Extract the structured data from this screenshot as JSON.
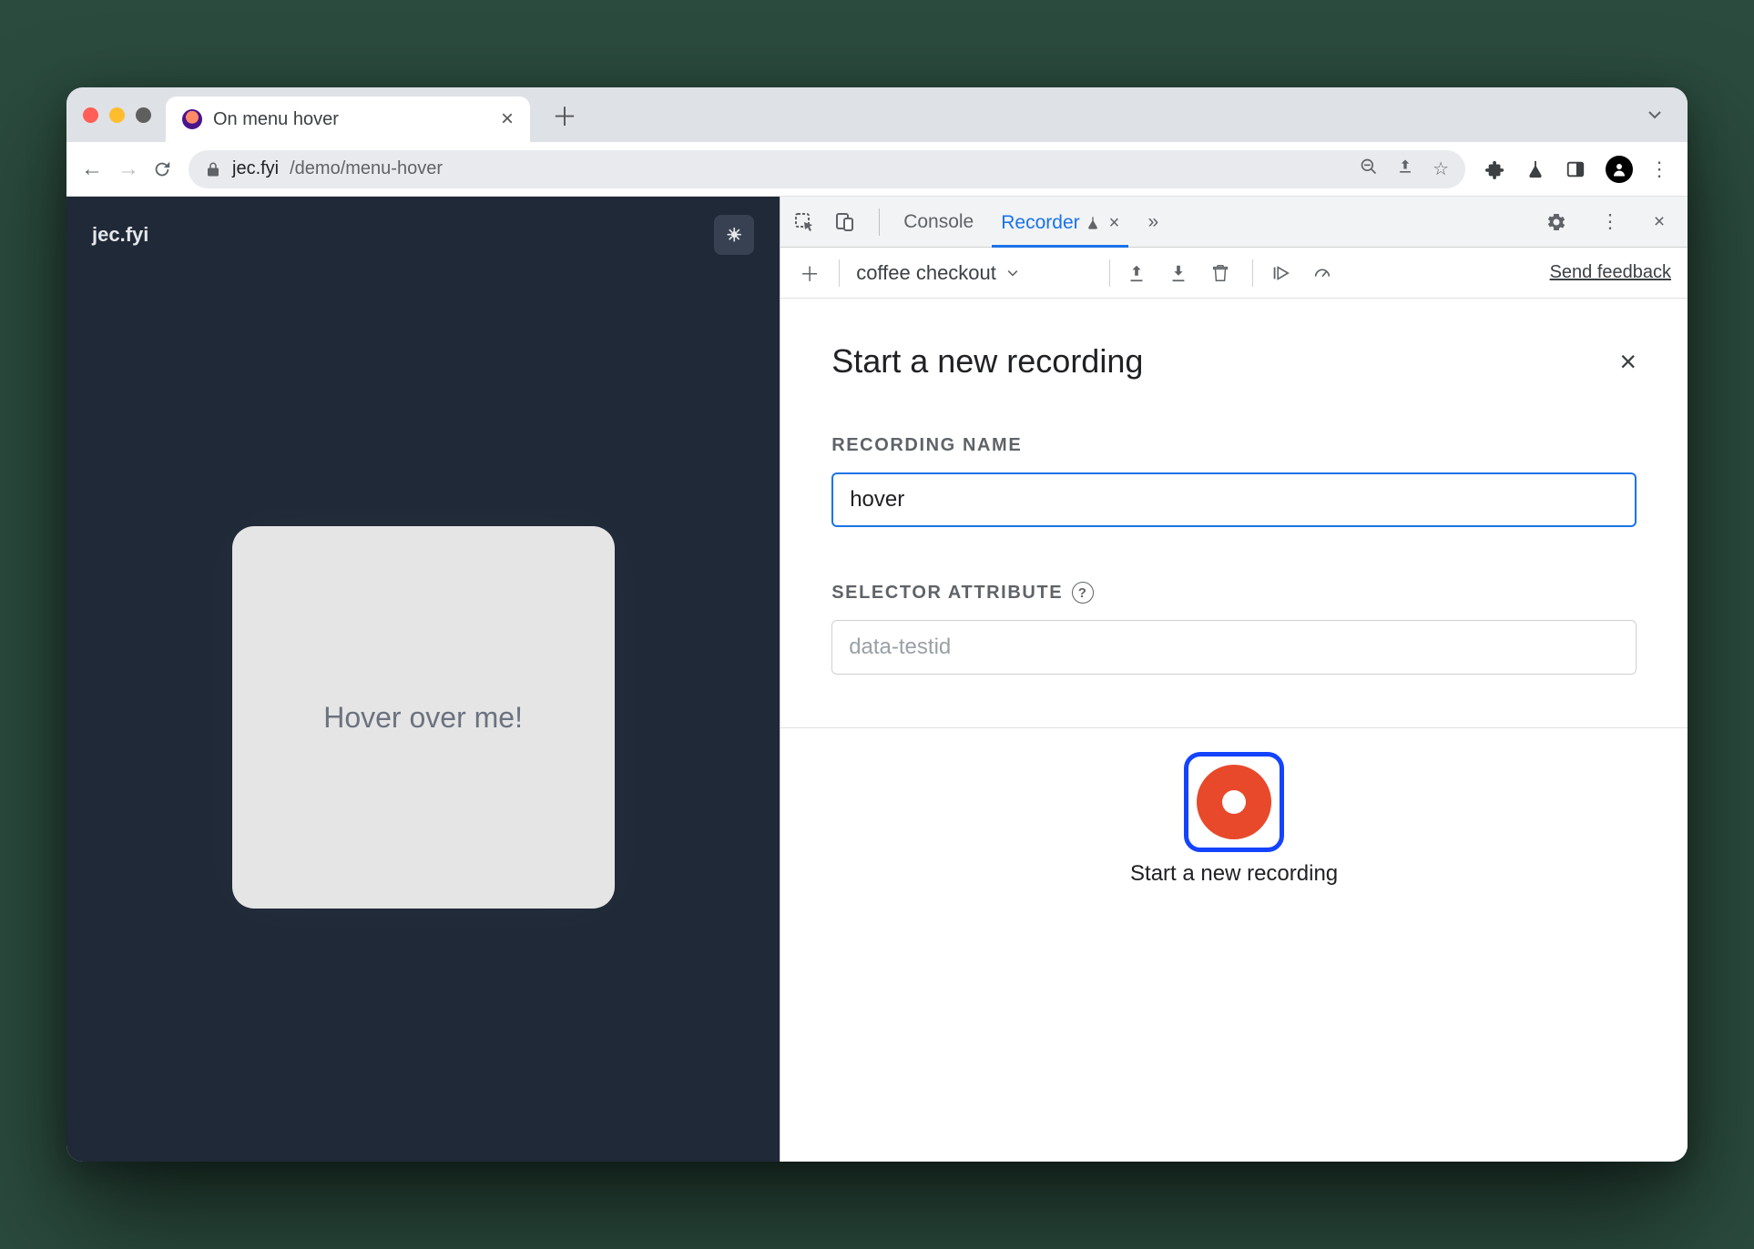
{
  "tab": {
    "title": "On menu hover"
  },
  "url": {
    "host": "jec.fyi",
    "path": "/demo/menu-hover"
  },
  "page": {
    "brand": "jec.fyi",
    "card_text": "Hover over me!"
  },
  "devtools": {
    "tabs": {
      "console": "Console",
      "recorder": "Recorder"
    },
    "recorder": {
      "dropdown_value": "coffee checkout",
      "feedback": "Send feedback"
    },
    "form": {
      "title": "Start a new recording",
      "name_label": "RECORDING NAME",
      "name_value": "hover",
      "selector_label": "SELECTOR ATTRIBUTE",
      "selector_placeholder": "data-testid",
      "button_label": "Start a new recording"
    }
  }
}
